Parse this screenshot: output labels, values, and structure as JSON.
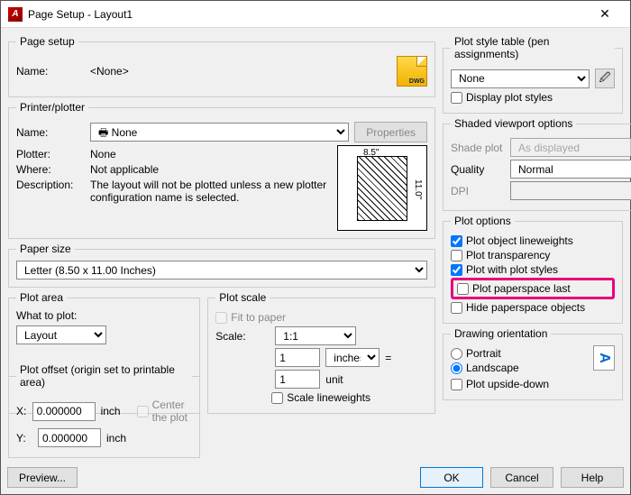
{
  "window": {
    "title": "Page Setup - Layout1"
  },
  "pageSetup": {
    "legend": "Page setup",
    "nameLabel": "Name:",
    "name": "<None>",
    "dwgLabel": "DWG"
  },
  "printer": {
    "legend": "Printer/plotter",
    "nameLabel": "Name:",
    "name": "None",
    "propsBtn": "Properties",
    "plotterLabel": "Plotter:",
    "plotter": "None",
    "whereLabel": "Where:",
    "where": "Not applicable",
    "descLabel": "Description:",
    "desc": "The layout will not be plotted unless a new plotter configuration name is selected.",
    "paperW": "8.5\"",
    "paperH": "11.0\""
  },
  "paperSize": {
    "legend": "Paper size",
    "value": "Letter (8.50 x 11.00 Inches)"
  },
  "plotArea": {
    "legend": "Plot area",
    "whatLabel": "What to plot:",
    "value": "Layout"
  },
  "plotScale": {
    "legend": "Plot scale",
    "fitLabel": "Fit to paper",
    "scaleLabel": "Scale:",
    "scale": "1:1",
    "numUnits": "1",
    "unitsSel": "inches",
    "equals": "=",
    "drawUnits": "1",
    "unitWord": "unit",
    "scaleLw": "Scale lineweights"
  },
  "plotOffset": {
    "legend": "Plot offset (origin set to printable area)",
    "xLabel": "X:",
    "yLabel": "Y:",
    "xVal": "0.000000",
    "yVal": "0.000000",
    "inch": "inch",
    "centerLabel": "Center the plot"
  },
  "plotStyle": {
    "legend": "Plot style table (pen assignments)",
    "value": "None",
    "displayLabel": "Display plot styles"
  },
  "shaded": {
    "legend": "Shaded viewport options",
    "shadeLabel": "Shade plot",
    "shadeVal": "As displayed",
    "qualityLabel": "Quality",
    "qualityVal": "Normal",
    "dpiLabel": "DPI",
    "dpiVal": ""
  },
  "plotOptions": {
    "legend": "Plot options",
    "o1": "Plot object lineweights",
    "o2": "Plot transparency",
    "o3": "Plot with plot styles",
    "o4": "Plot paperspace last",
    "o5": "Hide paperspace objects"
  },
  "orientation": {
    "legend": "Drawing orientation",
    "portrait": "Portrait",
    "landscape": "Landscape",
    "upside": "Plot upside-down",
    "letter": "A"
  },
  "footer": {
    "preview": "Preview...",
    "ok": "OK",
    "cancel": "Cancel",
    "help": "Help"
  }
}
